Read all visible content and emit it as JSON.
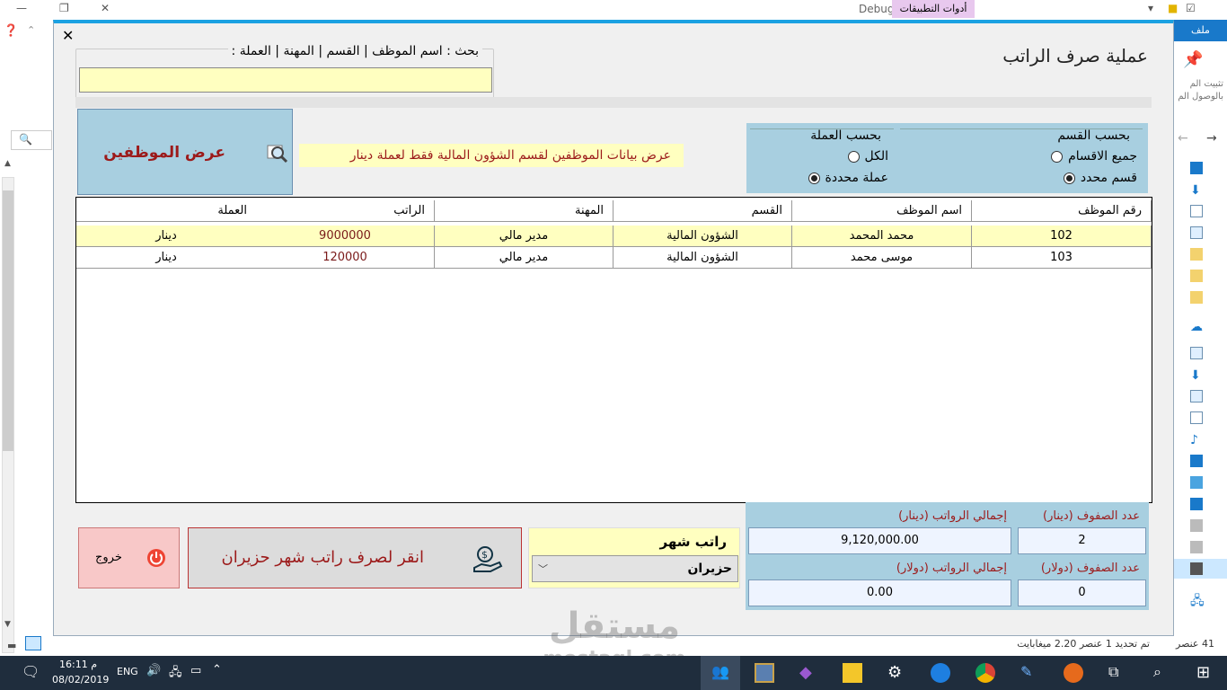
{
  "background": {
    "debug_label": "Debug",
    "app_tools_tab": "أدوات التطبيقات",
    "file_tab": "ملف",
    "pin_label": "تثبيت الم",
    "pin_label2": "بالوصول الم",
    "status_items": "41 عنصر",
    "status_selected": "تم تحديد 1 عنصر  2.20 ميغابايت"
  },
  "dialog": {
    "title": "عملية صرف الراتب",
    "close_symbol": "✕",
    "search": {
      "label": "بحث : اسم الموظف | القسم | المهنة | العملة :",
      "value": ""
    },
    "show_employees_button": "عرض الموظفين",
    "info_text": "عرض بيانات الموظفين لقسم  الشؤون المالية   فقط لعملة دينار",
    "by_department": {
      "title": "بحسب القسم",
      "options": [
        "جميع الاقسام",
        "قسم محدد"
      ],
      "selected": 1
    },
    "by_currency": {
      "title": "بحسب العملة",
      "options": [
        "الكل",
        "عملة محددة"
      ],
      "selected": 1
    },
    "grid": {
      "columns": [
        "رقم الموظف",
        "اسم الموظف",
        "القسم",
        "المهنة",
        "الراتب",
        "العملة"
      ],
      "rows": [
        [
          "102",
          "محمد المحمد",
          "الشؤون المالية",
          "مدير مالي",
          "9000000",
          "دينار"
        ],
        [
          "103",
          "موسى محمد",
          "الشؤون المالية",
          "مدير مالي",
          "120000",
          "دينار"
        ]
      ]
    },
    "exit_button": "خروج",
    "pay_button": "انقر لصرف راتب شهر   حزيران",
    "month": {
      "label": "راتب شهر",
      "selected": "حزيران"
    },
    "totals": {
      "rows_dinar_label": "عدد الصفوف (دينار)",
      "rows_dinar_value": "2",
      "salaries_dinar_label": "إجمالي الرواتب  (دينار)",
      "salaries_dinar_value": "9,120,000.00",
      "rows_dollar_label": "عدد الصفوف  (دولار)",
      "rows_dollar_value": "0",
      "salaries_dollar_label": "إجمالي الرواتب  (دولار)",
      "salaries_dollar_value": "0.00"
    }
  },
  "taskbar": {
    "time": "16:11 م",
    "date": "08/02/2019",
    "lang": "ENG"
  },
  "watermark": {
    "arabic": "مستقل",
    "latin": "mostaql.com"
  },
  "colors": {
    "accent_blue": "#a8cfe0",
    "highlight_yellow": "#ffffc0",
    "dark_red": "#9c1a1a",
    "taskbar": "#1f2d3d"
  }
}
